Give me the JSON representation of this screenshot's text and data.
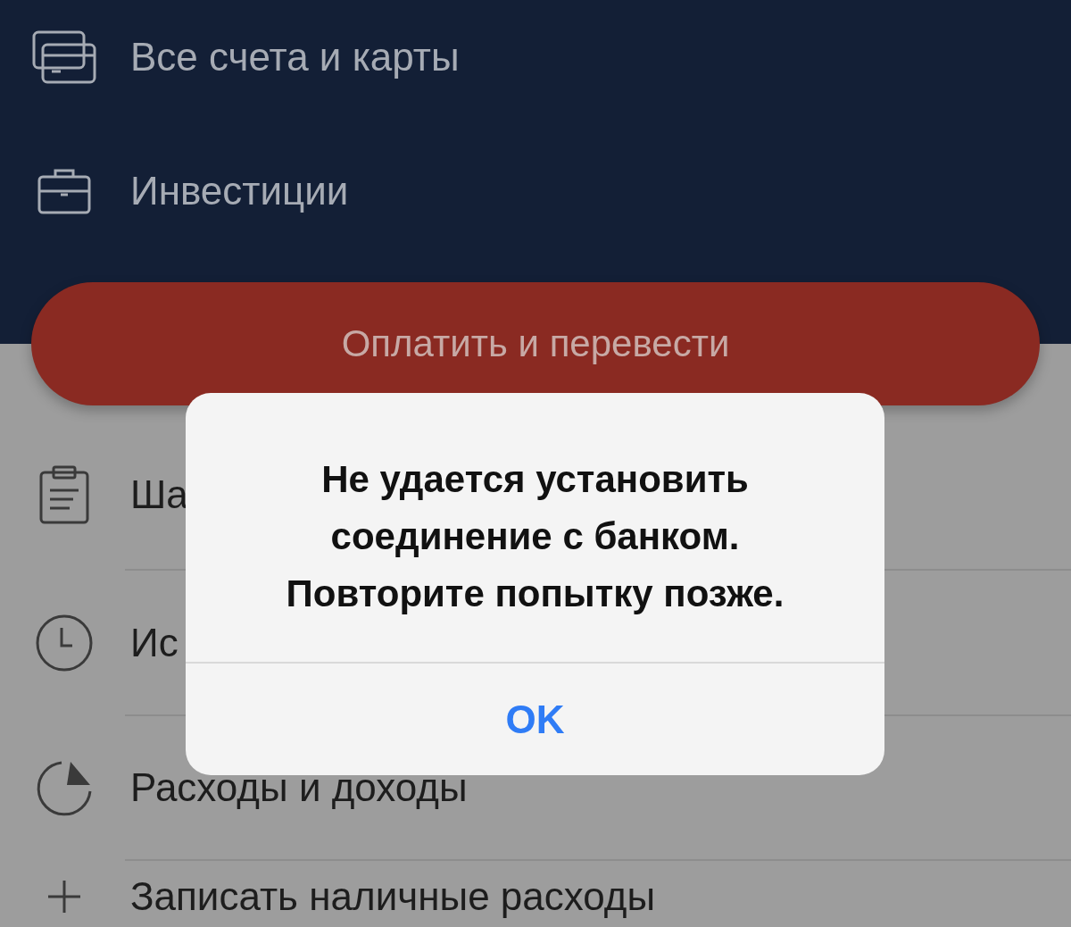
{
  "top_menu": [
    {
      "label": "Все счета и карты",
      "kind": "cards"
    },
    {
      "label": "Инвестиции",
      "kind": "briefcase"
    }
  ],
  "primary_button": {
    "label": "Оплатить и перевести"
  },
  "menu": [
    {
      "label": "Ша",
      "kind": "clipboard"
    },
    {
      "label": "Ис",
      "kind": "clock"
    },
    {
      "label": "Расходы и доходы",
      "kind": "pie"
    },
    {
      "label": "Записать наличные расходы",
      "kind": "plus"
    }
  ],
  "alert": {
    "message": "Не удается установить\nсоединение с банком.\nПовторите попытку позже.",
    "button": "OK"
  }
}
